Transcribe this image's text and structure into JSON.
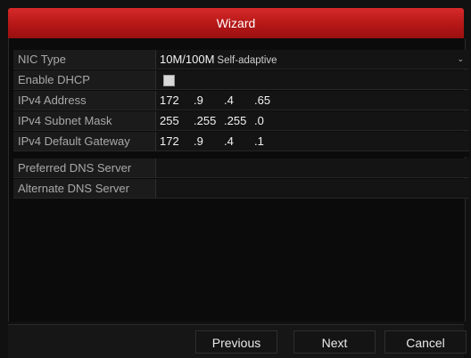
{
  "window": {
    "title": "Wizard"
  },
  "fields": {
    "nic_type": {
      "label": "NIC Type",
      "value_main": "10M/100M",
      "value_sub": "Self-adaptive"
    },
    "enable_dhcp": {
      "label": "Enable DHCP",
      "checked": false
    },
    "ipv4_address": {
      "label": "IPv4 Address",
      "octets": [
        "172",
        ".9",
        ".4",
        ".65"
      ]
    },
    "ipv4_subnet_mask": {
      "label": "IPv4 Subnet Mask",
      "octets": [
        "255",
        ".255",
        ".255",
        ".0"
      ]
    },
    "ipv4_default_gateway": {
      "label": "IPv4 Default Gateway",
      "octets": [
        "172",
        ".9",
        ".4",
        ".1"
      ]
    },
    "preferred_dns": {
      "label": "Preferred DNS Server",
      "value": ""
    },
    "alternate_dns": {
      "label": "Alternate DNS Server",
      "value": ""
    }
  },
  "buttons": {
    "previous": "Previous",
    "next": "Next",
    "cancel": "Cancel"
  },
  "icons": {
    "dropdown": "chevron-down-icon",
    "checkbox": "checkbox-icon"
  },
  "colors": {
    "title_bar": "#c41e1e",
    "background": "#0f0f0f"
  }
}
